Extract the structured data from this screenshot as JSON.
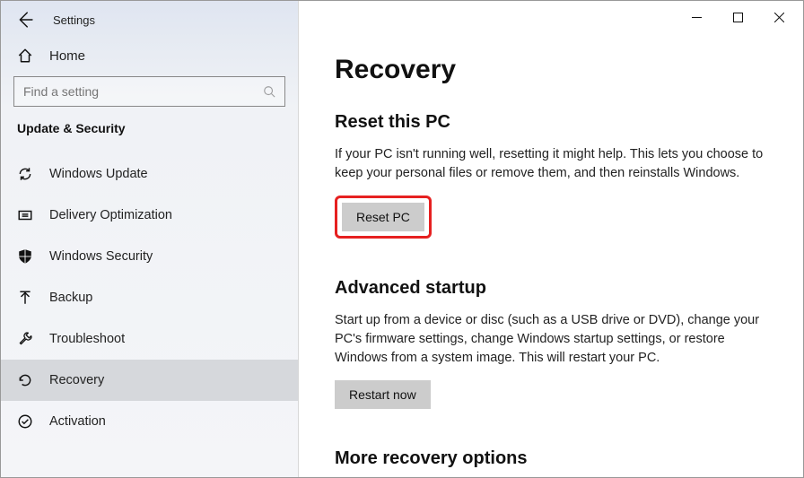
{
  "window": {
    "title": "Settings"
  },
  "sidebar": {
    "home_label": "Home",
    "search_placeholder": "Find a setting",
    "category": "Update & Security",
    "items": [
      {
        "label": "Windows Update"
      },
      {
        "label": "Delivery Optimization"
      },
      {
        "label": "Windows Security"
      },
      {
        "label": "Backup"
      },
      {
        "label": "Troubleshoot"
      },
      {
        "label": "Recovery"
      },
      {
        "label": "Activation"
      }
    ]
  },
  "page": {
    "title": "Recovery",
    "reset": {
      "title": "Reset this PC",
      "text": "If your PC isn't running well, resetting it might help. This lets you choose to keep your personal files or remove them, and then reinstalls Windows.",
      "button": "Reset PC"
    },
    "advanced": {
      "title": "Advanced startup",
      "text": "Start up from a device or disc (such as a USB drive or DVD), change your PC's firmware settings, change Windows startup settings, or restore Windows from a system image. This will restart your PC.",
      "button": "Restart now"
    },
    "more_title": "More recovery options"
  }
}
